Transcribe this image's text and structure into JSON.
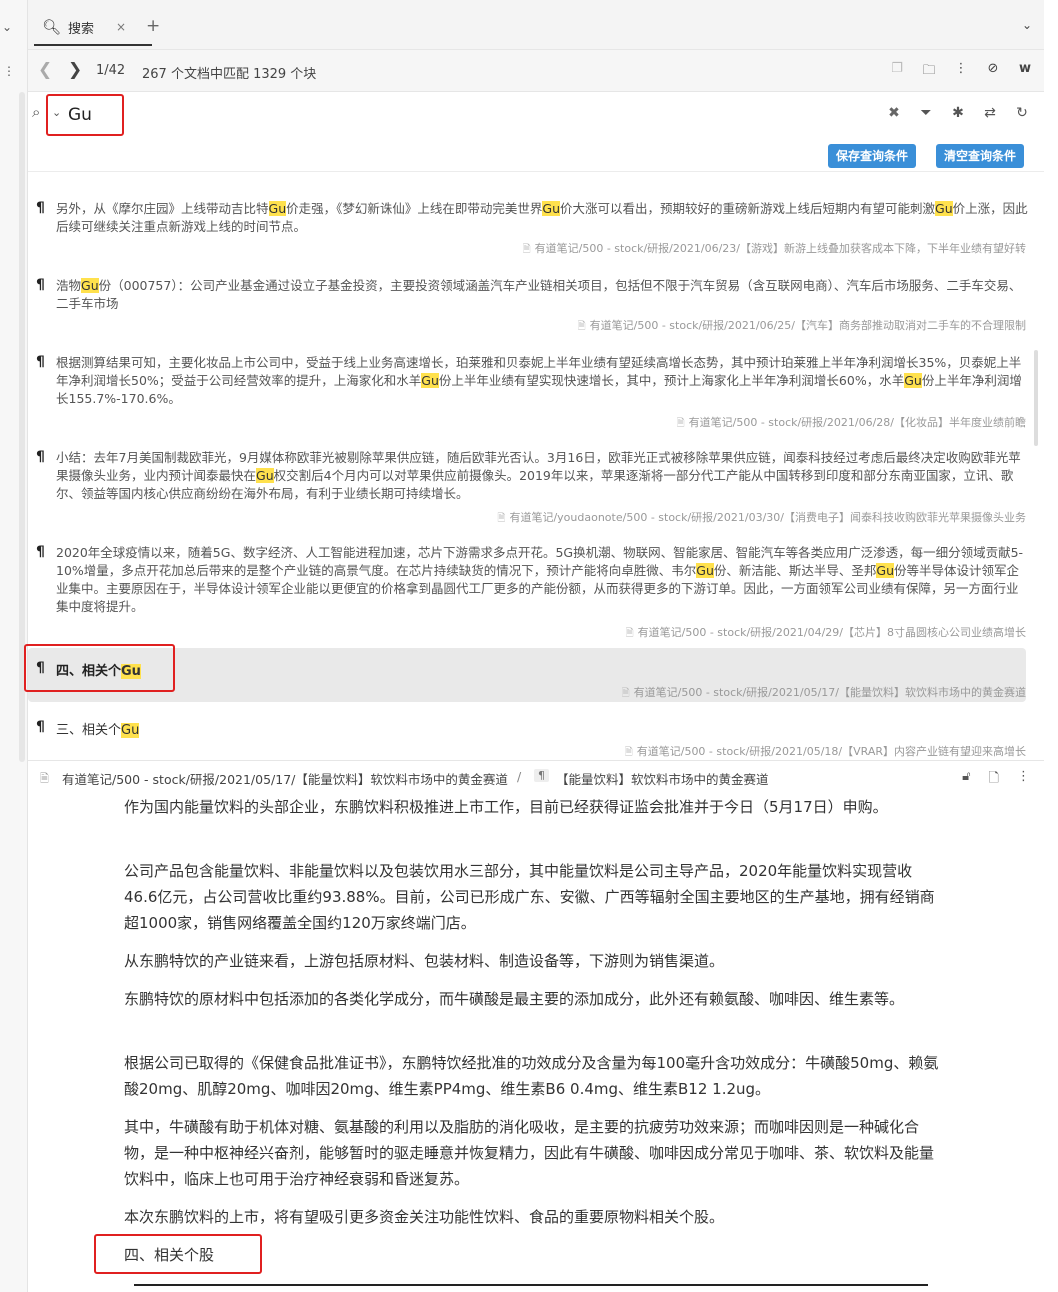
{
  "tabbar": {
    "tab_label": "搜索",
    "close_glyph": "×",
    "add_glyph": "+",
    "more_glyph": "⌄"
  },
  "results_header": {
    "count": "1/42",
    "summary": "267 个文档中匹配 1329 个块"
  },
  "search": {
    "query": "Gu"
  },
  "buttons": {
    "save_query": "保存查询条件",
    "clear_query": "清空查询条件"
  },
  "results": [
    {
      "text_parts": [
        "另外，从《摩尔庄园》上线带动吉比特",
        "Gu",
        "价走强，《梦幻新诛仙》上线在即带动完美世界",
        "Gu",
        "价大涨可以看出，预期较好的重磅新游戏上线后短期内有望可能刺激",
        "Gu",
        "价上涨，因此后续可继续关注重点新游戏上线的时间节点。"
      ],
      "path": "有道笔记/500 - stock/研报/2021/06/23/【游戏】新游上线叠加获客成本下降，下半年业绩有望好转"
    },
    {
      "text_parts": [
        "浩物",
        "Gu",
        "份（000757）：公司产业基金通过设立子基金投资，主要投资领域涵盖汽车产业链相关项目，包括但不限于汽车贸易（含互联网电商）、汽车后市场服务、二手车交易、二手车市场"
      ],
      "path": "有道笔记/500 - stock/研报/2021/06/25/【汽车】商务部推动取消对二手车的不合理限制"
    },
    {
      "text_parts": [
        "根据测算结果可知，主要化妆品上市公司中，受益于线上业务高速增长，珀莱雅和贝泰妮上半年业绩有望延续高增长态势，其中预计珀莱雅上半年净利润增长35%，贝泰妮上半年净利润增长50%；受益于公司经营效率的提升，上海家化和水羊",
        "Gu",
        "份上半年业绩有望实现快速增长，其中，预计上海家化上半年净利润增长60%，水羊",
        "Gu",
        "份上半年净利润增长155.7%-170.6%。"
      ],
      "path": "有道笔记/500 - stock/研报/2021/06/28/【化妆品】半年度业绩前瞻"
    },
    {
      "text_parts": [
        "小结：去年7月美国制裁欧菲光，9月媒体称欧菲光被剔除苹果供应链，随后欧菲光否认。3月16日，欧菲光正式被移除苹果供应链，闻泰科技经过考虑后最终决定收购欧菲光苹果摄像头业务，业内预计闻泰最快在",
        "Gu",
        "权交割后4个月内可以对苹果供应前摄像头。2019年以来，苹果逐渐将一部分代工产能从中国转移到印度和部分东南亚国家，立讯、歌尔、领益等国内核心供应商纷纷在海外布局，有利于业绩长期可持续增长。"
      ],
      "path": "有道笔记/youdaonote/500 - stock/研报/2021/03/30/【消费电子】闻泰科技收购欧菲光苹果摄像头业务"
    },
    {
      "text_parts": [
        "2020年全球疫情以来，随着5G、数字经济、人工智能进程加速，芯片下游需求多点开花。5G换机潮、物联网、智能家居、智能汽车等各类应用广泛渗透，每一细分领域贡献5-10%增量，多点开花加总后带来的是整个产业链的高景气度。在芯片持续缺货的情况下，预计产能将向卓胜微、韦尔",
        "Gu",
        "份、新洁能、斯达半导、圣邦",
        "Gu",
        "份等半导体设计领军企业集中。主要原因在于，半导体设计领军企业能以更便宜的价格拿到晶圆代工厂更多的产能份额，从而获得更多的下游订单。因此，一方面领军公司业绩有保障，另一方面行业集中度将提升。"
      ],
      "path": "有道笔记/500 - stock/研报/2021/04/29/【芯片】8寸晶圆核心公司业绩高增长"
    },
    {
      "title_prefix": "四、相关个",
      "title_hl": "Gu",
      "path": "有道笔记/500 - stock/研报/2021/05/17/【能量饮料】软饮料市场中的黄金赛道"
    },
    {
      "title_prefix": "三、相关个",
      "title_hl": "Gu",
      "path": "有道笔记/500 - stock/研报/2021/05/18/【VRAR】内容产业链有望迎来高增长"
    }
  ],
  "preview": {
    "path": "有道笔记/500 - stock/研报/2021/05/17/【能量饮料】软饮料市场中的黄金赛道",
    "sep": "/",
    "pil": "¶",
    "block_title": "【能量饮料】软饮料市场中的黄金赛道",
    "paragraphs": [
      "作为国内能量饮料的头部企业，东鹏饮料积极推进上市工作，目前已经获得证监会批准并于今日（5月17日）申购。",
      "公司产品包含能量饮料、非能量饮料以及包装饮用水三部分，其中能量饮料是公司主导产品，2020年能量饮料实现营收46.6亿元，占公司营收比重约93.88%。目前，公司已形成广东、安徽、广西等辐射全国主要地区的生产基地，拥有经销商超1000家，销售网络覆盖全国约120万家终端门店。",
      "从东鹏特饮的产业链来看，上游包括原材料、包装材料、制造设备等，下游则为销售渠道。",
      "东鹏特饮的原材料中包括添加的各类化学成分，而牛磺酸是最主要的添加成分，此外还有赖氨酸、咖啡因、维生素等。",
      "根据公司已取得的《保健食品批准证书》，东鹏特饮经批准的功效成分及含量为每100毫升含功效成分：牛磺酸50mg、赖氨酸20mg、肌醇20mg、咖啡因20mg、维生素PP4mg、维生素B6 0.4mg、维生素B12 1.2ug。",
      "其中，牛磺酸有助于机体对糖、氨基酸的利用以及脂肪的消化吸收，是主要的抗疲劳功效来源；而咖啡因则是一种碱化合物，是一种中枢神经兴奋剂，能够暂时的驱走睡意并恢复精力，因此有牛磺酸、咖啡因成分常见于咖啡、茶、软饮料及能量饮料中，临床上也可用于治疗神经衰弱和昏迷复苏。",
      "本次东鹏饮料的上市，将有望吸引更多资金关注功能性饮料、食品的重要原物料相关个股。",
      "四、相关个股"
    ]
  },
  "colors": {
    "accent": "#3a8fd8",
    "highlight": "#ffe14d",
    "annotation_red": "#e02020"
  }
}
